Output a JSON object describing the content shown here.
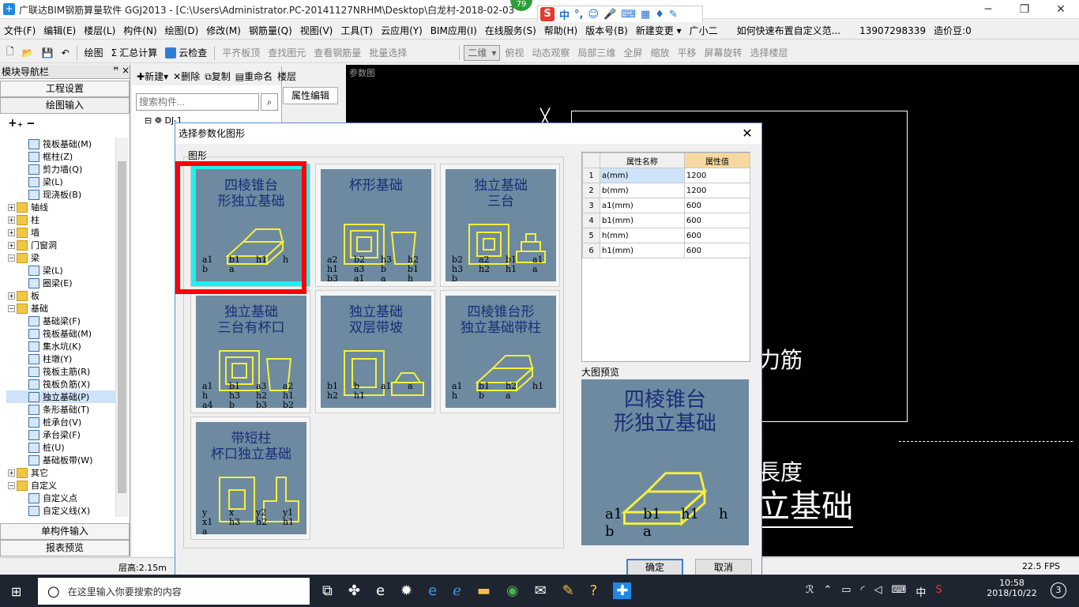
{
  "title_bar": {
    "title": "广联达BIM钢筋算量软件 GGJ2013 - [C:\\Users\\Administrator.PC-20141127NRHM\\Desktop\\白龙村-2018-02-03",
    "badge": "79",
    "ime": {
      "s": "S",
      "lang": "中",
      "punct": "°,"
    }
  },
  "menu": [
    "文件(F)",
    "编辑(E)",
    "楼层(L)",
    "构件(N)",
    "绘图(D)",
    "修改(M)",
    "钢筋量(Q)",
    "视图(V)",
    "工具(T)",
    "云应用(Y)",
    "BIM应用(I)",
    "在线服务(S)",
    "帮助(H)",
    "版本号(B)",
    "新建变更 ▾",
    "广小二",
    "如何快速布置自定义范...",
    "13907298339",
    "造价豆:0"
  ],
  "toolbar1": {
    "draw": "绘图",
    "sum": "汇总计算",
    "cloud_check": "云检查",
    "flush": "平齐板顶",
    "find": "查找图元",
    "view_qty": "查看钢筋量",
    "batch": "批量选择",
    "view_mode": "二维",
    "top_view": "俯视",
    "dynamic": "动态观察",
    "local3d": "局部三维",
    "fullscreen": "全屏",
    "zoom": "缩放",
    "pan": "平移",
    "rotate": "屏幕旋转",
    "select_floor": "选择楼层"
  },
  "nav": {
    "title": "模块导航栏",
    "pin": "ꟸ ×",
    "btn_project": "工程设置",
    "btn_draw": "绘图输入",
    "btn_single": "单构件输入",
    "btn_report": "报表预览",
    "tree": [
      {
        "label": "筏板基础(M)",
        "type": "comp",
        "indent": 2
      },
      {
        "label": "框柱(Z)",
        "type": "comp",
        "indent": 2
      },
      {
        "label": "剪力墙(Q)",
        "type": "comp",
        "indent": 2
      },
      {
        "label": "梁(L)",
        "type": "comp",
        "indent": 2
      },
      {
        "label": "现浇板(B)",
        "type": "comp",
        "indent": 2
      },
      {
        "label": "轴线",
        "type": "folder",
        "indent": 1,
        "exp": "+"
      },
      {
        "label": "柱",
        "type": "folder",
        "indent": 1,
        "exp": "+"
      },
      {
        "label": "墙",
        "type": "folder",
        "indent": 1,
        "exp": "+"
      },
      {
        "label": "门窗洞",
        "type": "folder",
        "indent": 1,
        "exp": "+"
      },
      {
        "label": "梁",
        "type": "folder",
        "indent": 1,
        "exp": "-"
      },
      {
        "label": "梁(L)",
        "type": "comp",
        "indent": 2
      },
      {
        "label": "圈梁(E)",
        "type": "comp",
        "indent": 2
      },
      {
        "label": "板",
        "type": "folder",
        "indent": 1,
        "exp": "+"
      },
      {
        "label": "基础",
        "type": "folder",
        "indent": 1,
        "exp": "-"
      },
      {
        "label": "基础梁(F)",
        "type": "comp",
        "indent": 2
      },
      {
        "label": "筏板基础(M)",
        "type": "comp",
        "indent": 2
      },
      {
        "label": "集水坑(K)",
        "type": "comp",
        "indent": 2
      },
      {
        "label": "柱墩(Y)",
        "type": "comp",
        "indent": 2
      },
      {
        "label": "筏板主筋(R)",
        "type": "comp",
        "indent": 2
      },
      {
        "label": "筏板负筋(X)",
        "type": "comp",
        "indent": 2
      },
      {
        "label": "独立基础(P)",
        "type": "comp",
        "indent": 2,
        "sel": true
      },
      {
        "label": "条形基础(T)",
        "type": "comp",
        "indent": 2
      },
      {
        "label": "桩承台(V)",
        "type": "comp",
        "indent": 2
      },
      {
        "label": "承台梁(F)",
        "type": "comp",
        "indent": 2
      },
      {
        "label": "桩(U)",
        "type": "comp",
        "indent": 2
      },
      {
        "label": "基础板带(W)",
        "type": "comp",
        "indent": 2
      },
      {
        "label": "其它",
        "type": "folder",
        "indent": 1,
        "exp": "+"
      },
      {
        "label": "自定义",
        "type": "folder",
        "indent": 1,
        "exp": "-"
      },
      {
        "label": "自定义点",
        "type": "comp",
        "indent": 2
      },
      {
        "label": "自定义线(X)",
        "type": "comp",
        "indent": 2
      }
    ]
  },
  "list": {
    "new": "新建",
    "delete": "删除",
    "copy": "复制",
    "rename": "重命名",
    "floor": "楼层",
    "search_placeholder": "搜索构件...",
    "first_item": "DJ-1",
    "props_tab": "属性编辑"
  },
  "canvas": {
    "label": "参数图",
    "text1": "力筋",
    "text2": "長度",
    "text3": "立基础"
  },
  "status": {
    "floor_height": "层高:2.15m",
    "fps": "22.5 FPS"
  },
  "dialog": {
    "title": "选择参数化图形",
    "group_label": "图形",
    "tiles": [
      {
        "t1": "四棱锥台",
        "t2": "形独立基础",
        "labels": [
          "a1",
          "b1",
          "h1",
          "h",
          "b",
          "a"
        ]
      },
      {
        "t1": "杯形基础",
        "t2": "",
        "labels": [
          "a2",
          "b2",
          "h3",
          "h2",
          "h1",
          "a3",
          "b",
          "b1",
          "b3",
          "a1",
          "a",
          "h"
        ]
      },
      {
        "t1": "独立基础",
        "t2": "三台",
        "labels": [
          "b2",
          "a2",
          "b1",
          "a1",
          "h3",
          "h2",
          "h1",
          "a",
          "b"
        ]
      },
      {
        "t1": "独立基础",
        "t2": "三台有杯口",
        "labels": [
          "a1",
          "b1",
          "a3",
          "a2",
          "h",
          "h3",
          "h2",
          "h1",
          "a4",
          "b",
          "b3",
          "b2",
          "a"
        ]
      },
      {
        "t1": "独立基础",
        "t2": "双层带坡",
        "labels": [
          "b1",
          "b",
          "a1",
          "a",
          "h2",
          "h1"
        ]
      },
      {
        "t1": "四棱锥台形",
        "t2": "独立基础带柱",
        "labels": [
          "a1",
          "b1",
          "h2",
          "h1",
          "h",
          "b",
          "a"
        ]
      },
      {
        "t1": "带短柱",
        "t2": "杯口独立基础",
        "labels": [
          "y",
          "x",
          "y2",
          "y1",
          "x1",
          "h3",
          "h2",
          "h1",
          "a"
        ]
      }
    ],
    "prop_table": {
      "col_name": "属性名称",
      "col_value": "属性值",
      "rows": [
        {
          "n": "1",
          "name": "a(mm)",
          "value": "1200"
        },
        {
          "n": "2",
          "name": "b(mm)",
          "value": "1200"
        },
        {
          "n": "3",
          "name": "a1(mm)",
          "value": "600"
        },
        {
          "n": "4",
          "name": "b1(mm)",
          "value": "600"
        },
        {
          "n": "5",
          "name": "h(mm)",
          "value": "600"
        },
        {
          "n": "6",
          "name": "h1(mm)",
          "value": "600"
        }
      ]
    },
    "preview_label": "大图预览",
    "preview": {
      "t1": "四棱锥台",
      "t2": "形独立基础",
      "labels": [
        "a1",
        "b1",
        "h1",
        "h",
        "b",
        "a"
      ]
    },
    "ok": "确定",
    "cancel": "取消"
  },
  "taskbar": {
    "search": "在这里输入你要搜索的内容",
    "time": "10:58",
    "date": "2018/10/22",
    "lang": "中",
    "notif": "3"
  }
}
